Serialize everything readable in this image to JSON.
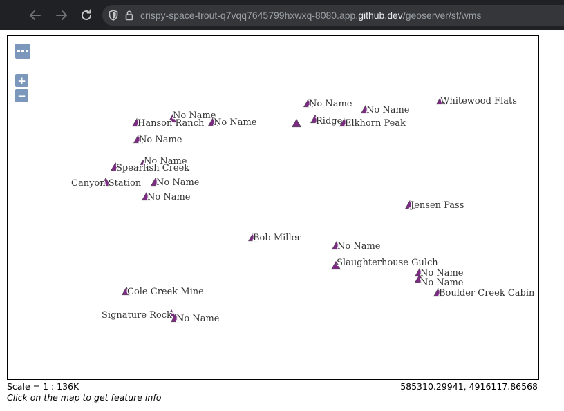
{
  "browser": {
    "url_host_prefix": "crispy-space-trout-q7vqq7645799hxwxq-8080.app.",
    "url_host_domain": "github.dev",
    "url_path": "/geoserver/sf/wms"
  },
  "map": {
    "symbol_color": "#7b2c82",
    "controls": {
      "toolbar_icon": "ellipsis-icon",
      "zoom_in": "+",
      "zoom_out": "−"
    },
    "features": [
      {
        "label": "No Name"
      },
      {
        "label": "Hanson Ranch"
      },
      {
        "label": "No Name"
      },
      {
        "label": "No Name"
      },
      {
        "label": "No Name"
      },
      {
        "label": "Spearfish Creek"
      },
      {
        "label": "Canyon Station"
      },
      {
        "label": "No Name"
      },
      {
        "label": "No Name"
      },
      {
        "label": "No Name"
      },
      {
        "label": ""
      },
      {
        "label": "Ridge"
      },
      {
        "label": "Elkhorn Peak"
      },
      {
        "label": "No Name"
      },
      {
        "label": "Whitewood Flats"
      },
      {
        "label": "Jensen Pass"
      },
      {
        "label": "Bob Miller"
      },
      {
        "label": "No Name"
      },
      {
        "label": "Slaughterhouse Gulch"
      },
      {
        "label": "No Name"
      },
      {
        "label": "No Name"
      },
      {
        "label": "Boulder Creek Cabin"
      },
      {
        "label": "Cole Creek Mine"
      },
      {
        "label": "Signature Rock"
      },
      {
        "label": "No Name"
      }
    ]
  },
  "footer": {
    "scale": "Scale = 1 : 136K",
    "coordinates": "585310.29941, 4916117.86568",
    "hint": "Click on the map to get feature info"
  }
}
